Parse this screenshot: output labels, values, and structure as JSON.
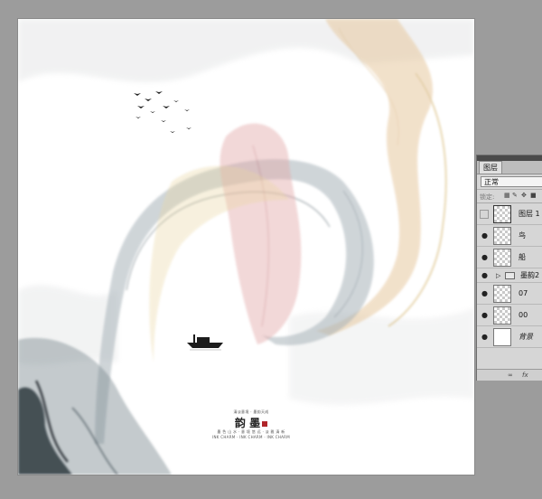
{
  "layers_panel": {
    "tab": "图层",
    "blend_mode": "正常",
    "lock_label": "锁定:",
    "lock_icons": [
      "checkerboard-lock-icon",
      "brush-lock-icon",
      "move-lock-icon",
      "padlock-icon"
    ],
    "layers": [
      {
        "name": "图层 1",
        "visible": false,
        "thumb": "transparent",
        "selected": true
      },
      {
        "name": "鸟",
        "visible": true,
        "thumb": "transparent",
        "selected": false
      },
      {
        "name": "船",
        "visible": true,
        "thumb": "transparent",
        "selected": false
      },
      {
        "name": "墨韵2",
        "visible": true,
        "group": true
      },
      {
        "name": "07",
        "visible": true,
        "thumb": "transparent",
        "selected": false
      },
      {
        "name": "00",
        "visible": true,
        "thumb": "transparent",
        "selected": false
      },
      {
        "name": "背景",
        "visible": true,
        "thumb": "white",
        "selected": false,
        "italic": true
      }
    ],
    "footer_icons": [
      "link-icon",
      "fx-icon"
    ],
    "footer_fx": "fx"
  },
  "canvas": {
    "caption_line1": "清淡意境 · 墨韵天成",
    "title": "韵 墨",
    "caption_line2": "墨 色 山 水 · 意 境 悠 远 · 淡 雅 清 新",
    "caption_line3": "INK CHARM · INK CHARM · INK CHARM",
    "colors": {
      "ink": "#3d4a52",
      "red": "#b94a55",
      "gold": "#c9a24a",
      "bg": "#ffffff"
    }
  }
}
